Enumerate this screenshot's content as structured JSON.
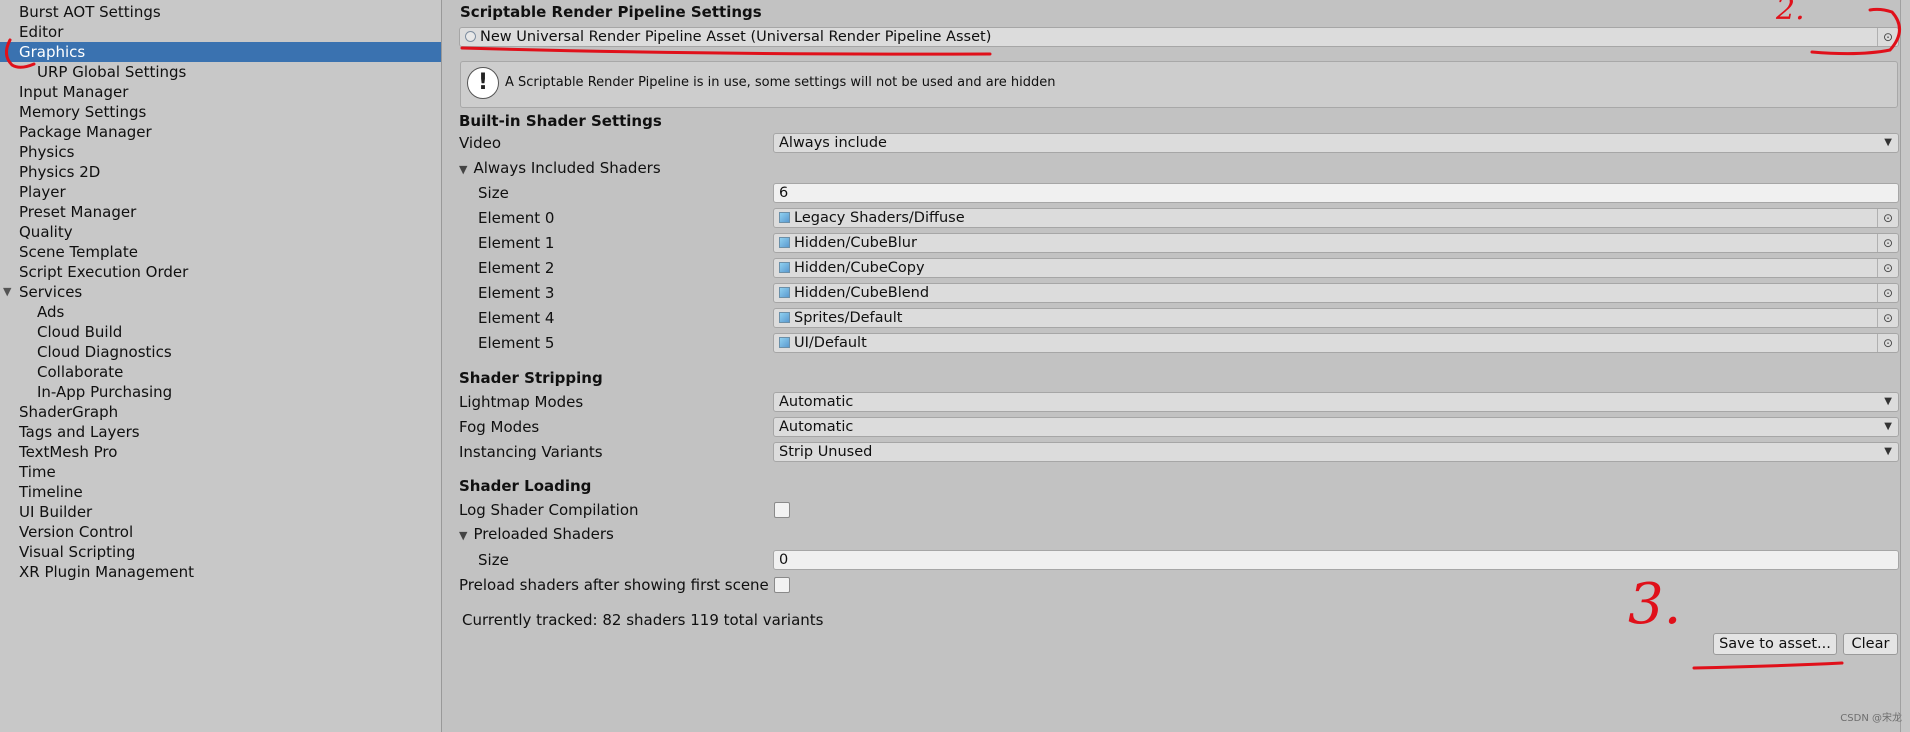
{
  "sidebar": {
    "items": [
      {
        "label": "Burst AOT Settings",
        "level": 0
      },
      {
        "label": "Editor",
        "level": 0
      },
      {
        "label": "Graphics",
        "level": 0,
        "selected": true
      },
      {
        "label": "URP Global Settings",
        "level": 1
      },
      {
        "label": "Input Manager",
        "level": 0
      },
      {
        "label": "Memory Settings",
        "level": 0
      },
      {
        "label": "Package Manager",
        "level": 0
      },
      {
        "label": "Physics",
        "level": 0
      },
      {
        "label": "Physics 2D",
        "level": 0
      },
      {
        "label": "Player",
        "level": 0
      },
      {
        "label": "Preset Manager",
        "level": 0
      },
      {
        "label": "Quality",
        "level": 0
      },
      {
        "label": "Scene Template",
        "level": 0
      },
      {
        "label": "Script Execution Order",
        "level": 0
      },
      {
        "label": "Services",
        "level": 0,
        "expanded": true
      },
      {
        "label": "Ads",
        "level": 1
      },
      {
        "label": "Cloud Build",
        "level": 1
      },
      {
        "label": "Cloud Diagnostics",
        "level": 1
      },
      {
        "label": "Collaborate",
        "level": 1
      },
      {
        "label": "In-App Purchasing",
        "level": 1
      },
      {
        "label": "ShaderGraph",
        "level": 0
      },
      {
        "label": "Tags and Layers",
        "level": 0
      },
      {
        "label": "TextMesh Pro",
        "level": 0
      },
      {
        "label": "Time",
        "level": 0
      },
      {
        "label": "Timeline",
        "level": 0
      },
      {
        "label": "UI Builder",
        "level": 0
      },
      {
        "label": "Version Control",
        "level": 0
      },
      {
        "label": "Visual Scripting",
        "level": 0
      },
      {
        "label": "XR Plugin Management",
        "level": 0
      }
    ]
  },
  "srp": {
    "header": "Scriptable Render Pipeline Settings",
    "asset": "New Universal Render Pipeline Asset (Universal Render Pipeline Asset)",
    "info": "A Scriptable Render Pipeline is in use, some settings will not be used and are hidden"
  },
  "builtin": {
    "header": "Built-in Shader Settings",
    "video_label": "Video",
    "video_value": "Always include",
    "always_included_label": "Always Included Shaders",
    "size_label": "Size",
    "size_value": "6",
    "elements": [
      {
        "label": "Element 0",
        "value": "Legacy Shaders/Diffuse"
      },
      {
        "label": "Element 1",
        "value": "Hidden/CubeBlur"
      },
      {
        "label": "Element 2",
        "value": "Hidden/CubeCopy"
      },
      {
        "label": "Element 3",
        "value": "Hidden/CubeBlend"
      },
      {
        "label": "Element 4",
        "value": "Sprites/Default"
      },
      {
        "label": "Element 5",
        "value": "UI/Default"
      }
    ]
  },
  "stripping": {
    "header": "Shader Stripping",
    "rows": [
      {
        "label": "Lightmap Modes",
        "value": "Automatic"
      },
      {
        "label": "Fog Modes",
        "value": "Automatic"
      },
      {
        "label": "Instancing Variants",
        "value": "Strip Unused"
      }
    ]
  },
  "loading": {
    "header": "Shader Loading",
    "log_label": "Log Shader Compilation",
    "log_checked": false,
    "preloaded_label": "Preloaded Shaders",
    "size_label": "Size",
    "size_value": "0",
    "preload_after_label": "Preload shaders after showing first scene",
    "preload_after_checked": false,
    "tracked": "Currently tracked: 82 shaders 119 total variants",
    "save_button": "Save to asset...",
    "clear_button": "Clear"
  },
  "icons": {
    "picker": "⊙",
    "dropdown": "▼",
    "expanded": "▼",
    "warning": "!"
  },
  "annotations": {
    "label2": "2.",
    "label3": "3.",
    "color": "#e0101a"
  },
  "watermark": "CSDN @宋龙"
}
